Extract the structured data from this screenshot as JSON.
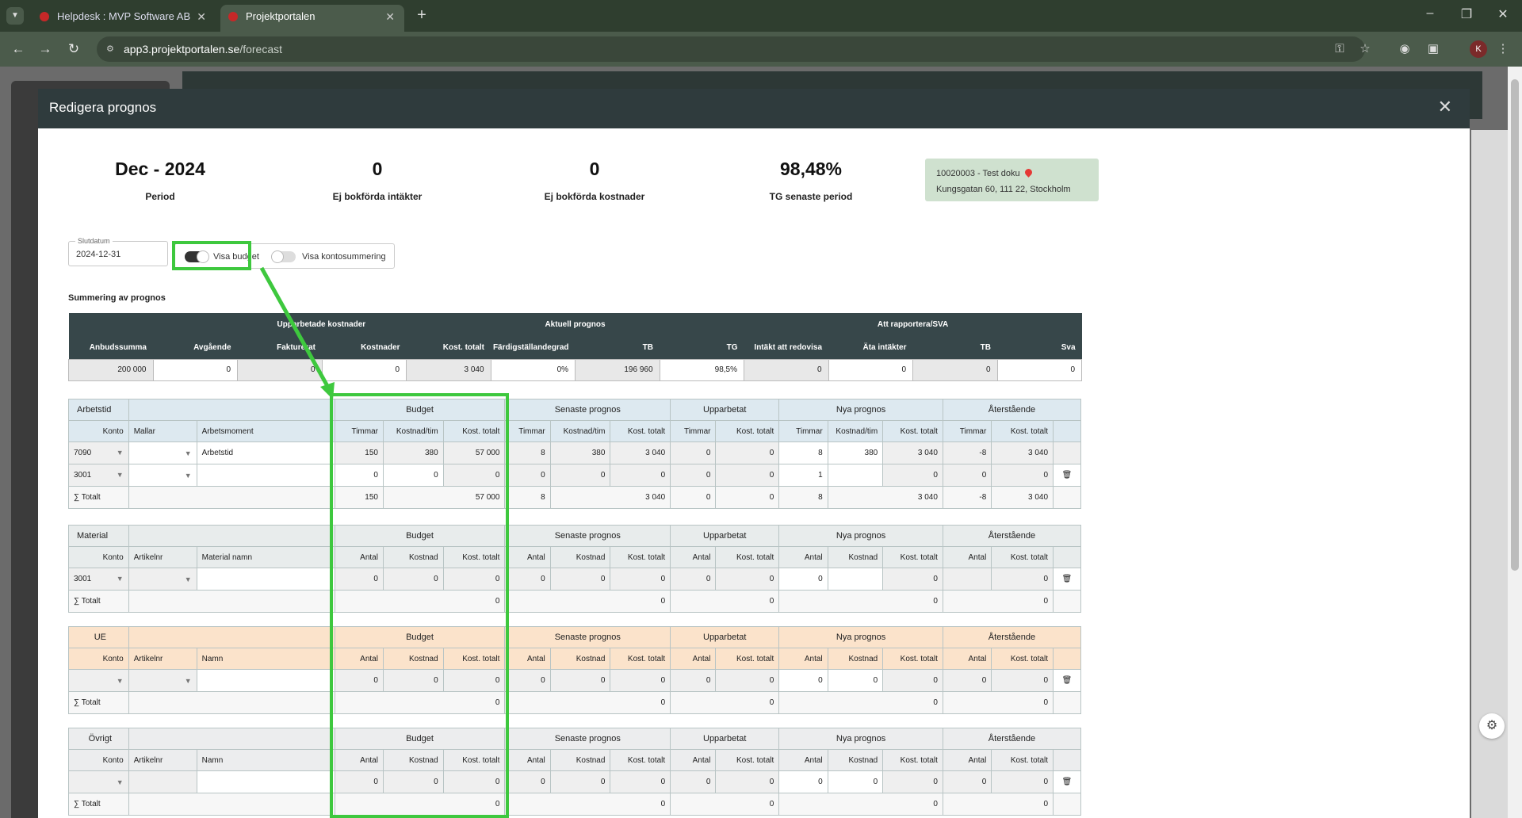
{
  "browser": {
    "tabs": [
      {
        "title": "Helpdesk : MVP Software AB"
      },
      {
        "title": "Projektportalen"
      }
    ],
    "url_host": "app3.projektportalen.se",
    "url_path": "/forecast",
    "profile_initial": "K"
  },
  "modal": {
    "title": "Redigera prognos",
    "stats": [
      {
        "value": "Dec - 2024",
        "label": "Period"
      },
      {
        "value": "0",
        "label": "Ej bokförda intäkter"
      },
      {
        "value": "0",
        "label": "Ej bokförda kostnader"
      },
      {
        "value": "98,48%",
        "label": "TG senaste period"
      }
    ],
    "project": {
      "line1": "10020003 - Test doku",
      "line2": "Kungsgatan 60, 111 22, Stockholm"
    },
    "slutdatum": {
      "label": "Slutdatum",
      "value": "2024-12-31"
    },
    "toggles": {
      "visa_budget": "Visa budget",
      "visa_kontosummering": "Visa kontosummering"
    },
    "summary": {
      "title": "Summering av prognos",
      "groups": [
        "Upparbetade kostnader",
        "Aktuell prognos",
        "Att rapportera/SVA"
      ],
      "columns": [
        "Anbudssumma",
        "Avgående",
        "Fakturerat",
        "Kostnader",
        "Kost. totalt",
        "Färdigställandegrad",
        "TB",
        "TG",
        "Intäkt att redovisa",
        "Äta intäkter",
        "TB",
        "Sva"
      ],
      "values": [
        "200 000",
        "0",
        "0",
        "0",
        "3 040",
        "0%",
        "196 960",
        "98,5%",
        "0",
        "0",
        "0",
        "0"
      ]
    },
    "groups_labels": {
      "budget": "Budget",
      "senaste": "Senaste prognos",
      "upparbetat": "Upparbetat",
      "nya": "Nya prognos",
      "aterstaende": "Återstående",
      "konto": "Konto",
      "totalt": "Totalt",
      "timmar": "Timmar",
      "kostnad_tim": "Kostnad/tim",
      "kost_totalt": "Kost. totalt",
      "antal": "Antal",
      "kostnad": "Kostnad",
      "artikelnr": "Artikelnr",
      "mallar": "Mallar",
      "namn": "Namn"
    },
    "arbetstid": {
      "name": "Arbetstid",
      "moment_header": "Arbetsmoment",
      "rows": [
        {
          "konto": "7090",
          "moment": "Arbetstid",
          "b": [
            "150",
            "380",
            "57 000"
          ],
          "s": [
            "8",
            "380",
            "3 040"
          ],
          "u": [
            "0",
            "0"
          ],
          "n": [
            "8",
            "380",
            "3 040"
          ],
          "a": [
            "-8",
            "3 040"
          ]
        },
        {
          "konto": "3001",
          "moment": "",
          "b": [
            "0",
            "0",
            "0"
          ],
          "s": [
            "0",
            "0",
            "0"
          ],
          "u": [
            "0",
            "0"
          ],
          "n": [
            "1",
            "",
            "0"
          ],
          "a": [
            "0",
            "0"
          ]
        }
      ],
      "total": {
        "b": [
          "150",
          "57 000"
        ],
        "s": [
          "8",
          "3 040"
        ],
        "u": [
          "0",
          "0"
        ],
        "n": [
          "8",
          "3 040"
        ],
        "a": [
          "-8",
          "3 040"
        ]
      }
    },
    "material": {
      "name": "Material",
      "name_header": "Material namn",
      "row": {
        "konto": "3001",
        "b": [
          "0",
          "0",
          "0"
        ],
        "s": [
          "0",
          "0",
          "0"
        ],
        "u": [
          "0",
          "0"
        ],
        "n": [
          "0",
          "",
          "0"
        ],
        "a": [
          "",
          "0"
        ]
      },
      "total": {
        "b": "0",
        "s": "0",
        "u": "0",
        "n": "0",
        "a": "0"
      }
    },
    "ue": {
      "name": "UE",
      "row": {
        "konto": "",
        "b": [
          "0",
          "0",
          "0"
        ],
        "s": [
          "0",
          "0",
          "0"
        ],
        "u": [
          "0",
          "0"
        ],
        "n": [
          "0",
          "0",
          "0"
        ],
        "a": [
          "0",
          "0"
        ]
      },
      "total": {
        "b": "0",
        "s": "0",
        "u": "0",
        "n": "0",
        "a": "0"
      }
    },
    "ovrigt": {
      "name": "Övrigt",
      "row": {
        "konto": "",
        "b": [
          "0",
          "0",
          "0"
        ],
        "s": [
          "0",
          "0",
          "0"
        ],
        "u": [
          "0",
          "0"
        ],
        "n": [
          "0",
          "0",
          "0"
        ],
        "a": [
          "0",
          "0"
        ]
      },
      "total": {
        "b": "0",
        "s": "0",
        "u": "0",
        "n": "0",
        "a": "0"
      }
    }
  },
  "colors": {
    "highlight": "#3ec83e",
    "header_dark": "#37474a",
    "modal_head": "#2f3b3d"
  }
}
